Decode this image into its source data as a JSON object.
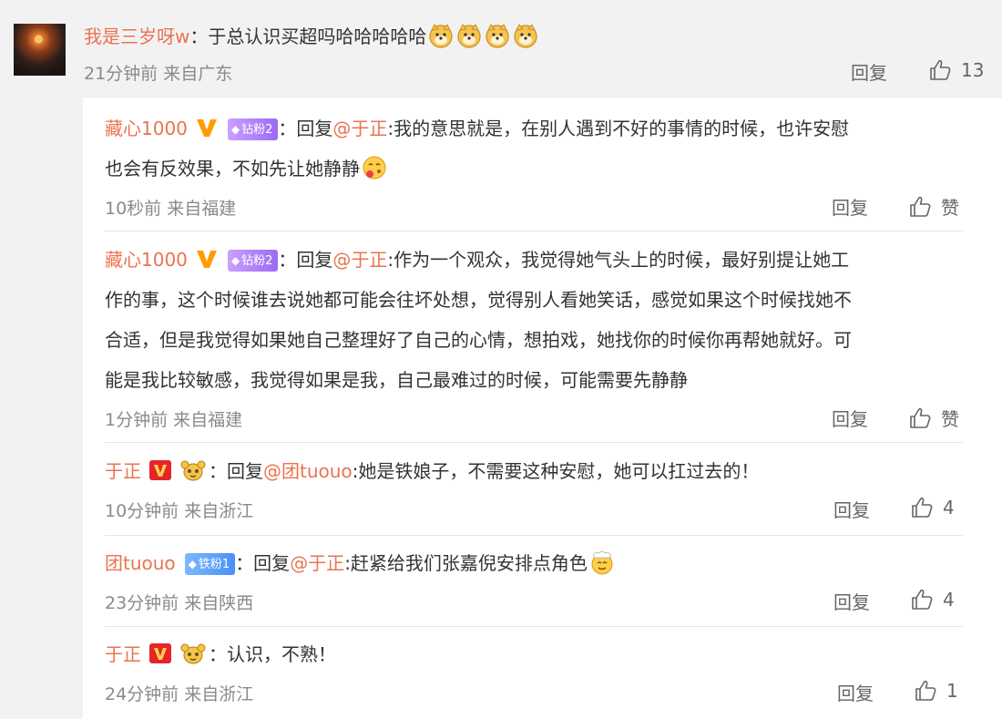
{
  "top_comment": {
    "username": "我是三岁呀w",
    "text": "：于总认识买超吗哈哈哈哈哈",
    "emoji_name": "doge-icon",
    "meta": "21分钟前  来自广东",
    "reply_label": "回复",
    "likes": "13"
  },
  "replies": [
    {
      "username": "藏心1000",
      "fan_badge": "钻粉2",
      "prefix": "：回复",
      "mention": "@于正",
      "lines": [
        ":我的意思就是，在别人遇到不好的事情的时候，也许安慰",
        "也会有反效果，不如先让她静静"
      ],
      "meta": "10秒前  来自福建",
      "reply_label": "回复",
      "likes": "赞"
    },
    {
      "username": "藏心1000",
      "fan_badge": "钻粉2",
      "prefix": "：回复",
      "mention": "@于正",
      "lines": [
        ":作为一个观众，我觉得她气头上的时候，最好别提让她工",
        "作的事，这个时候谁去说她都可能会往坏处想，觉得别人看她笑话，感觉如果这个时候找她不",
        "合适，但是我觉得如果她自己整理好了自己的心情，想拍戏，她找你的时候你再帮她就好。可",
        "能是我比较敏感，我觉得如果是我，自己最难过的时候，可能需要先静静"
      ],
      "meta": "1分钟前  来自福建",
      "reply_label": "回复",
      "likes": "赞"
    },
    {
      "username": "于正",
      "prefix": "：回复",
      "mention": "@团tuouo",
      "lines": [
        ":她是铁娘子，不需要这种安慰，她可以扛过去的！"
      ],
      "meta": "10分钟前  来自浙江",
      "reply_label": "回复",
      "likes": "4"
    },
    {
      "username": "团tuouo",
      "fan_badge": "铁粉1",
      "prefix": "：回复",
      "mention": "@于正",
      "lines": [
        ":赶紧给我们张嘉倪安排点角色"
      ],
      "meta": "23分钟前  来自陕西",
      "reply_label": "回复",
      "likes": "4"
    },
    {
      "username": "于正",
      "prefix": "：认识，不熟！",
      "meta": "24分钟前  来自浙江",
      "reply_label": "回复",
      "likes": "1"
    }
  ],
  "colors": {
    "username": "#eb7350",
    "meta": "#8a8a8a",
    "vip_orange": "#ff9d00",
    "vip_red": "#e5252a"
  }
}
